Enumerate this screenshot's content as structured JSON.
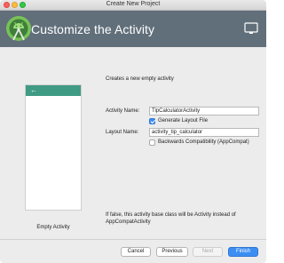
{
  "window": {
    "title": "Create New Project"
  },
  "header": {
    "title": "Customize the Activity",
    "logo_icon": "android-studio-logo",
    "device_icon": "tablet-device-icon",
    "banner_color": "#616f7a"
  },
  "main": {
    "subtitle": "Creates a new empty activity",
    "preview": {
      "label": "Empty Activity",
      "back_arrow": "←",
      "bar_color": "#3f9b84"
    },
    "activity_name": {
      "label": "Activity Name:",
      "value": "TipCalculatorActivity"
    },
    "generate_layout": {
      "label": "Generate Layout File",
      "checked": true
    },
    "layout_name": {
      "label": "Layout Name:",
      "value": "activity_tip_calculator"
    },
    "backwards_compat": {
      "label": "Backwards Compatibility (AppCompat)",
      "checked": false
    },
    "hint": "If false, this activity base class will be Activity instead of AppCompatActivity"
  },
  "footer": {
    "cancel": "Cancel",
    "previous": "Previous",
    "next": "Next",
    "finish": "Finish",
    "primary_color": "#3c8ef3"
  }
}
